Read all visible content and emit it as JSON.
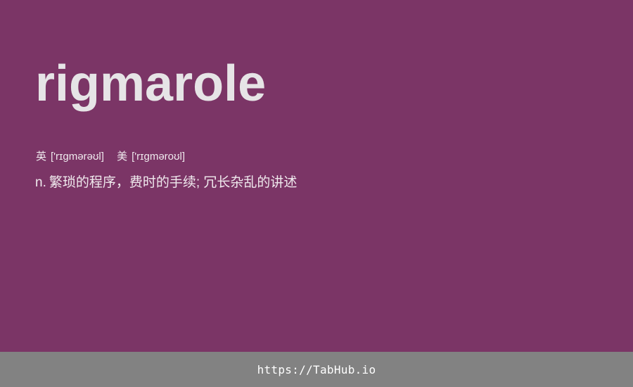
{
  "word": "rigmarole",
  "phonetics": [
    {
      "region": "英",
      "ipa": "['rɪɡmərəʊl]"
    },
    {
      "region": "美",
      "ipa": "['rɪɡməroʊl]"
    }
  ],
  "definition": {
    "part_of_speech": "n.",
    "meaning": "繁琐的程序，费时的手续; 冗长杂乱的讲述"
  },
  "footer": {
    "link": "https://TabHub.io"
  },
  "colors": {
    "background": "#7b3566",
    "footer_background": "#828282",
    "text": "#e6e4e6"
  }
}
